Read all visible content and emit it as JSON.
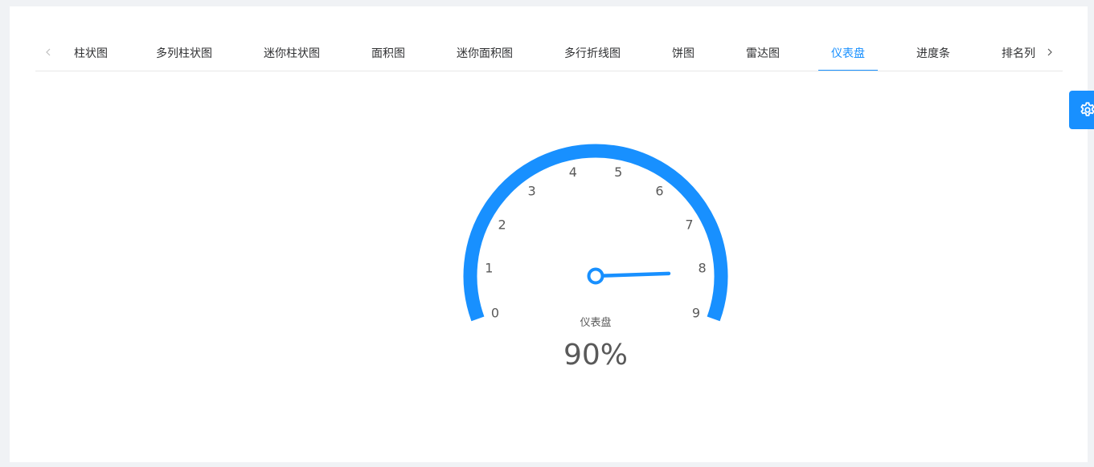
{
  "tabs": {
    "items": [
      {
        "label": "柱状图"
      },
      {
        "label": "多列柱状图"
      },
      {
        "label": "迷你柱状图"
      },
      {
        "label": "面积图"
      },
      {
        "label": "迷你面积图"
      },
      {
        "label": "多行折线图"
      },
      {
        "label": "饼图"
      },
      {
        "label": "雷达图"
      },
      {
        "label": "仪表盘"
      },
      {
        "label": "进度条"
      },
      {
        "label": "排名列"
      }
    ],
    "active_index": 8,
    "prev_icon": "chevron-left-icon",
    "next_icon": "chevron-right-icon"
  },
  "settings": {
    "icon": "gear-icon",
    "color": "#1890ff"
  },
  "chart_data": {
    "type": "gauge",
    "min": 0,
    "max": 9,
    "ticks": [
      "0",
      "1",
      "2",
      "3",
      "4",
      "5",
      "6",
      "7",
      "8",
      "9"
    ],
    "value_fraction": 0.9,
    "title": "仪表盘",
    "value_label": "90%",
    "color": "#1890ff"
  }
}
